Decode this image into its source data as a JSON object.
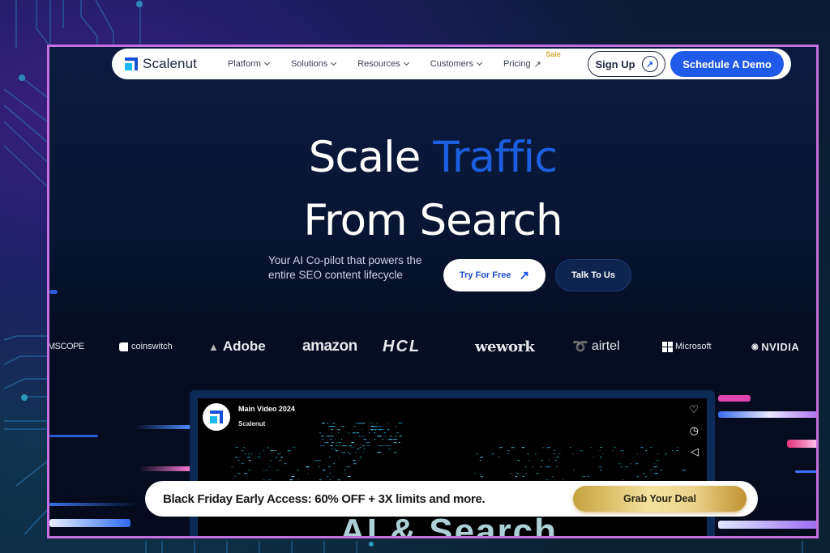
{
  "nav": {
    "logo_text": "Scalenut",
    "items": [
      {
        "label": "Platform",
        "icon": "chevron-down-icon"
      },
      {
        "label": "Solutions",
        "icon": "chevron-down-icon"
      },
      {
        "label": "Resources",
        "icon": "chevron-down-icon"
      },
      {
        "label": "Customers",
        "icon": "chevron-down-icon"
      },
      {
        "label": "Pricing",
        "icon": "arrow-up-right-icon",
        "badge": "Sale"
      }
    ],
    "signup_label": "Sign Up",
    "demo_label": "Schedule A Demo"
  },
  "hero": {
    "title_line1_a": "Scale ",
    "title_line1_b": "Traffic",
    "title_line2": "From Search",
    "tagline": "Your AI Co-pilot that powers the entire SEO content lifecycle",
    "try_label": "Try For Free",
    "talk_label": "Talk To Us"
  },
  "logos": [
    "MSCOPE",
    "coinswitch",
    "Adobe",
    "amazon",
    "HCL",
    "wework",
    "airtel",
    "Microsoft",
    "NVIDIA"
  ],
  "video": {
    "title": "Main Video 2024",
    "channel": "Scalenut",
    "overlay_text": "AI & Search",
    "icons": [
      "heart-icon",
      "clock-icon",
      "share-icon"
    ]
  },
  "promo": {
    "text": "Black Friday Early Access: 60% OFF + 3X limits and more.",
    "button_label": "Grab Your Deal"
  },
  "colors": {
    "accent": "#1f5ae8",
    "frame": "#c56fe0",
    "sale": "#d6a53a"
  }
}
